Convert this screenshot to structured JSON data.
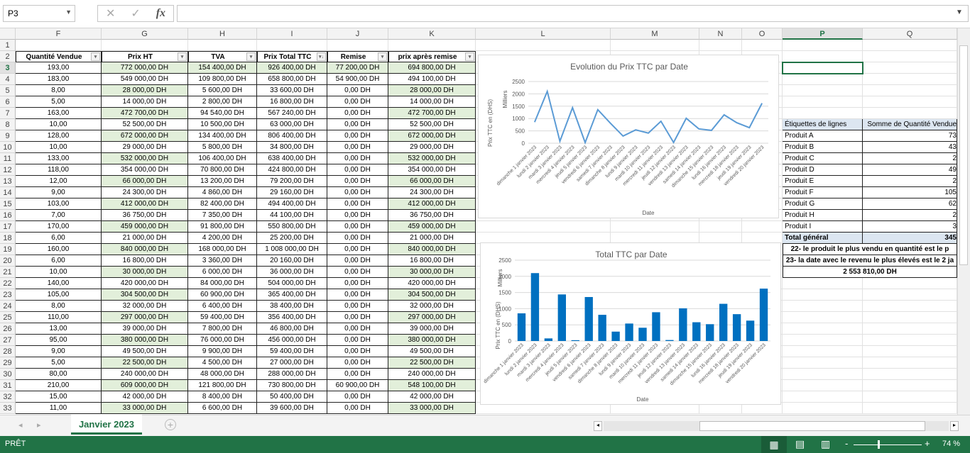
{
  "formula_bar": {
    "name_box": "P3",
    "formula": "",
    "cancel_icon": "✕",
    "enter_icon": "✓",
    "fx_label": "fx"
  },
  "columns": [
    "F",
    "G",
    "H",
    "I",
    "J",
    "K",
    "L",
    "M",
    "N",
    "O",
    "P",
    "Q"
  ],
  "selected_column": "P",
  "selected_row": 3,
  "selected_cell": "P3",
  "table": {
    "headers": [
      "Quantité Vendue",
      "Prix HT",
      "TVA",
      "Prix Total  TTC",
      "Remise",
      "prix après remise"
    ],
    "rows": [
      [
        "193,00",
        "772 000,00 DH",
        "154 400,00 DH",
        "926 400,00 DH",
        "77 200,00 DH",
        "694 800,00 DH"
      ],
      [
        "183,00",
        "549 000,00 DH",
        "109 800,00 DH",
        "658 800,00 DH",
        "54 900,00 DH",
        "494 100,00 DH"
      ],
      [
        "8,00",
        "28 000,00 DH",
        "5 600,00 DH",
        "33 600,00 DH",
        "0,00 DH",
        "28 000,00 DH"
      ],
      [
        "5,00",
        "14 000,00 DH",
        "2 800,00 DH",
        "16 800,00 DH",
        "0,00 DH",
        "14 000,00 DH"
      ],
      [
        "163,00",
        "472 700,00 DH",
        "94 540,00 DH",
        "567 240,00 DH",
        "0,00 DH",
        "472 700,00 DH"
      ],
      [
        "10,00",
        "52 500,00 DH",
        "10 500,00 DH",
        "63 000,00 DH",
        "0,00 DH",
        "52 500,00 DH"
      ],
      [
        "128,00",
        "672 000,00 DH",
        "134 400,00 DH",
        "806 400,00 DH",
        "0,00 DH",
        "672 000,00 DH"
      ],
      [
        "10,00",
        "29 000,00 DH",
        "5 800,00 DH",
        "34 800,00 DH",
        "0,00 DH",
        "29 000,00 DH"
      ],
      [
        "133,00",
        "532 000,00 DH",
        "106 400,00 DH",
        "638 400,00 DH",
        "0,00 DH",
        "532 000,00 DH"
      ],
      [
        "118,00",
        "354 000,00 DH",
        "70 800,00 DH",
        "424 800,00 DH",
        "0,00 DH",
        "354 000,00 DH"
      ],
      [
        "12,00",
        "66 000,00 DH",
        "13 200,00 DH",
        "79 200,00 DH",
        "0,00 DH",
        "66 000,00 DH"
      ],
      [
        "9,00",
        "24 300,00 DH",
        "4 860,00 DH",
        "29 160,00 DH",
        "0,00 DH",
        "24 300,00 DH"
      ],
      [
        "103,00",
        "412 000,00 DH",
        "82 400,00 DH",
        "494 400,00 DH",
        "0,00 DH",
        "412 000,00 DH"
      ],
      [
        "7,00",
        "36 750,00 DH",
        "7 350,00 DH",
        "44 100,00 DH",
        "0,00 DH",
        "36 750,00 DH"
      ],
      [
        "170,00",
        "459 000,00 DH",
        "91 800,00 DH",
        "550 800,00 DH",
        "0,00 DH",
        "459 000,00 DH"
      ],
      [
        "6,00",
        "21 000,00 DH",
        "4 200,00 DH",
        "25 200,00 DH",
        "0,00 DH",
        "21 000,00 DH"
      ],
      [
        "160,00",
        "840 000,00 DH",
        "168 000,00 DH",
        "1 008 000,00 DH",
        "0,00 DH",
        "840 000,00 DH"
      ],
      [
        "6,00",
        "16 800,00 DH",
        "3 360,00 DH",
        "20 160,00 DH",
        "0,00 DH",
        "16 800,00 DH"
      ],
      [
        "10,00",
        "30 000,00 DH",
        "6 000,00 DH",
        "36 000,00 DH",
        "0,00 DH",
        "30 000,00 DH"
      ],
      [
        "140,00",
        "420 000,00 DH",
        "84 000,00 DH",
        "504 000,00 DH",
        "0,00 DH",
        "420 000,00 DH"
      ],
      [
        "105,00",
        "304 500,00 DH",
        "60 900,00 DH",
        "365 400,00 DH",
        "0,00 DH",
        "304 500,00 DH"
      ],
      [
        "8,00",
        "32 000,00 DH",
        "6 400,00 DH",
        "38 400,00 DH",
        "0,00 DH",
        "32 000,00 DH"
      ],
      [
        "110,00",
        "297 000,00 DH",
        "59 400,00 DH",
        "356 400,00 DH",
        "0,00 DH",
        "297 000,00 DH"
      ],
      [
        "13,00",
        "39 000,00 DH",
        "7 800,00 DH",
        "46 800,00 DH",
        "0,00 DH",
        "39 000,00 DH"
      ],
      [
        "95,00",
        "380 000,00 DH",
        "76 000,00 DH",
        "456 000,00 DH",
        "0,00 DH",
        "380 000,00 DH"
      ],
      [
        "9,00",
        "49 500,00 DH",
        "9 900,00 DH",
        "59 400,00 DH",
        "0,00 DH",
        "49 500,00 DH"
      ],
      [
        "5,00",
        "22 500,00 DH",
        "4 500,00 DH",
        "27 000,00 DH",
        "0,00 DH",
        "22 500,00 DH"
      ],
      [
        "80,00",
        "240 000,00 DH",
        "48 000,00 DH",
        "288 000,00 DH",
        "0,00 DH",
        "240 000,00 DH"
      ],
      [
        "210,00",
        "609 000,00 DH",
        "121 800,00 DH",
        "730 800,00 DH",
        "60 900,00 DH",
        "548 100,00 DH"
      ],
      [
        "15,00",
        "42 000,00 DH",
        "8 400,00 DH",
        "50 400,00 DH",
        "0,00 DH",
        "42 000,00 DH"
      ],
      [
        "11,00",
        "33 000,00 DH",
        "6 600,00 DH",
        "39 600,00 DH",
        "0,00 DH",
        "33 000,00 DH"
      ]
    ]
  },
  "pivot": {
    "header": [
      "Étiquettes de lignes",
      "Somme de Quantité Vendue"
    ],
    "rows": [
      [
        "Produit A",
        "73"
      ],
      [
        "Produit B",
        "43"
      ],
      [
        "Produit C",
        "2"
      ],
      [
        "Produit D",
        "49"
      ],
      [
        "Produit E",
        "2"
      ],
      [
        "Produit F",
        "105"
      ],
      [
        "Produit G",
        "62"
      ],
      [
        "Produit H",
        "2"
      ],
      [
        "Produit I",
        "3"
      ]
    ],
    "total": [
      "Total général",
      "345"
    ],
    "notes": [
      "22- le produit le plus vendu en quantité est le p",
      "23- la date avec le revenu le plus élevés est le 2 ja",
      "2 553 810,00 DH"
    ]
  },
  "chart_data": [
    {
      "type": "line",
      "title": "Evolution du Prix TTC par Date",
      "xlabel": "Date",
      "ylabel": "Prix TTC en (DHS)",
      "unit_label": "Milliers",
      "ylim": [
        0,
        2500
      ],
      "yticks": [
        0,
        500,
        1000,
        1500,
        2000,
        2500
      ],
      "grid": true,
      "color": "#5b9bd5",
      "categories": [
        "dimanche 1 janvier 2023",
        "lundi 2 janvier 2023",
        "mardi 3 janvier 2023",
        "mercredi 4 janvier 2023",
        "jeudi 5 janvier 2023",
        "vendredi 6 janvier 2023",
        "samedi 7 janvier 2023",
        "dimanche 8 janvier 2023",
        "lundi 9 janvier 2023",
        "mardi 10 janvier 2023",
        "mercredi 11 janvier 2023",
        "jeudi 12 janvier 2023",
        "vendredi 13 janvier 2023",
        "samedi 14 janvier 2023",
        "dimanche 15 janvier 2023",
        "lundi 16 janvier 2023",
        "mercredi 18 janvier 2023",
        "jeudi 19 janvier 2023",
        "vendredi 20 janvier 2023"
      ],
      "values": [
        855,
        2100,
        80,
        1440,
        25,
        1360,
        810,
        290,
        540,
        410,
        890,
        30,
        1010,
        580,
        520,
        1150,
        830,
        630,
        1620
      ]
    },
    {
      "type": "bar",
      "title": "Total TTC par Date",
      "xlabel": "Date",
      "ylabel": "Prix TTC en (DHS)",
      "unit_label": "Milliers",
      "ylim": [
        0,
        2500
      ],
      "yticks": [
        0,
        500,
        1000,
        1500,
        2000,
        2500
      ],
      "grid": true,
      "color": "#0070c0",
      "categories": [
        "dimanche 1 janvier 2023",
        "lundi 2 janvier 2023",
        "mardi 3 janvier 2023",
        "mercredi 4 janvier 2023",
        "jeudi 5 janvier 2023",
        "vendredi 6 janvier 2023",
        "samedi 7 janvier 2023",
        "dimanche 8 janvier 2023",
        "lundi 9 janvier 2023",
        "mardi 10 janvier 2023",
        "mercredi 11 janvier 2023",
        "jeudi 12 janvier 2023",
        "vendredi 13 janvier 2023",
        "samedi 14 janvier 2023",
        "dimanche 15 janvier 2023",
        "lundi 16 janvier 2023",
        "mercredi 18 janvier 2023",
        "jeudi 19 janvier 2023",
        "vendredi 20 janvier 2023"
      ],
      "values": [
        855,
        2100,
        80,
        1440,
        25,
        1360,
        810,
        290,
        540,
        410,
        890,
        30,
        1010,
        580,
        520,
        1150,
        830,
        630,
        1620
      ]
    }
  ],
  "sheet_tabs": [
    {
      "label": "Janvier 2023",
      "active": true
    }
  ],
  "status": {
    "mode": "PRÊT",
    "zoom": "74 %"
  },
  "colors": {
    "accent": "#217346",
    "band": "#e2efda",
    "pivot_header": "#dce6f1"
  }
}
